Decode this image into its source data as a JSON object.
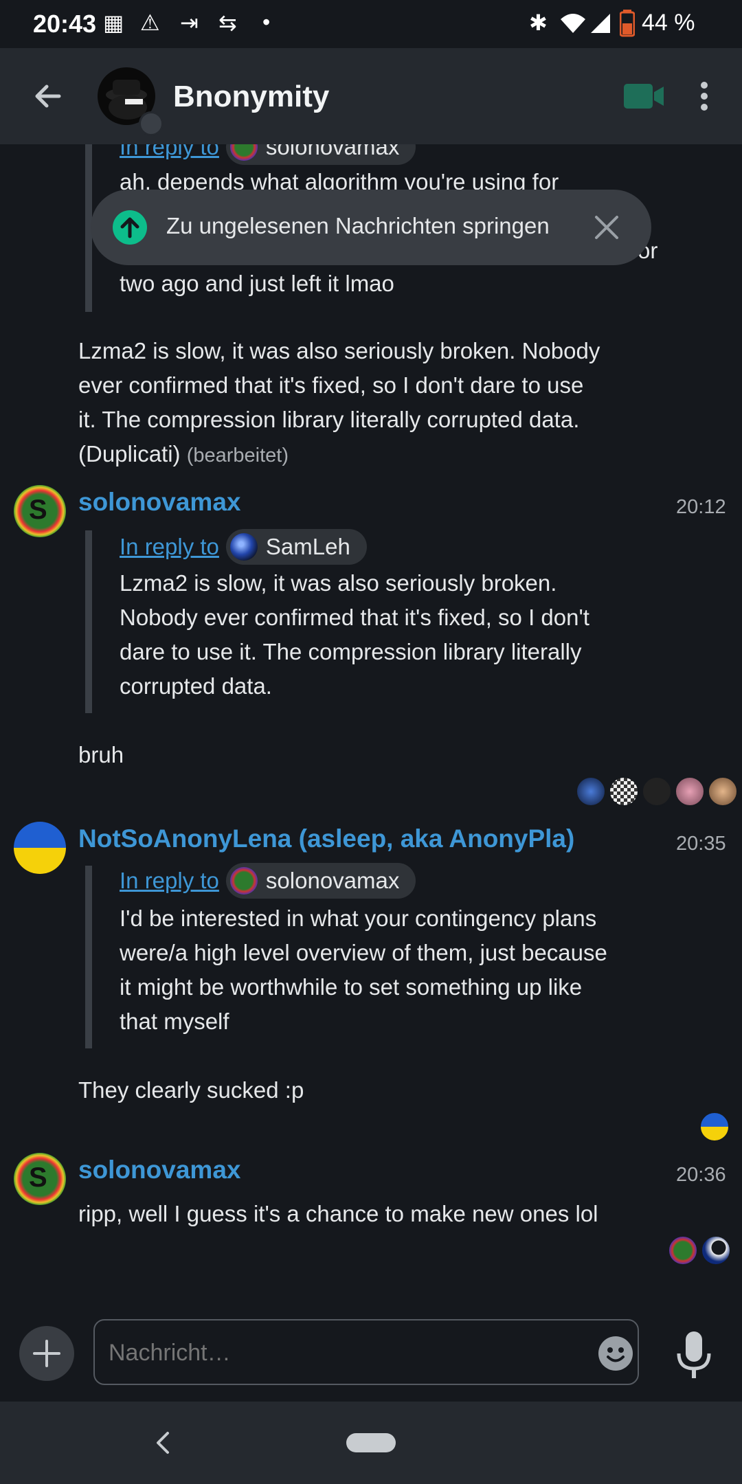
{
  "status_bar": {
    "time": "20:43",
    "battery": "44 %",
    "icons": [
      "grid-icon",
      "warning-icon",
      "cast-icon",
      "sync-icon",
      "dot-icon",
      "bluetooth-icon",
      "wifi-icon",
      "signal-icon",
      "battery-icon"
    ]
  },
  "header": {
    "title": "Bnonymity",
    "back_icon": "arrow-left-icon",
    "video_icon": "video-camera-icon",
    "menu_icon": "more-vertical-icon"
  },
  "jump_banner": {
    "label": "Zu ungelesenen Nachrichten springen"
  },
  "top_quote": {
    "reply_to": "In reply to",
    "user": "solonovamax",
    "line1": "ah, depends what algorithm you're using for",
    "partial": "or",
    "line3": "two ago and just left it lmao"
  },
  "msg_a": {
    "text_lines": [
      "Lzma2 is slow, it was also seriously broken. Nobody",
      "ever confirmed that it's fixed, so I don't dare to use",
      "it. The compression library literally corrupted data."
    ],
    "last_line": "(Duplicati)",
    "edited": "(bearbeitet)"
  },
  "msg_b": {
    "sender": "solonovamax",
    "time": "20:12",
    "reply_to": "In reply to",
    "reply_user": "SamLeh",
    "quote_lines": [
      "Lzma2 is slow, it was also seriously broken.",
      "Nobody ever confirmed that it's fixed, so I don't",
      "dare to use it. The compression library literally",
      "corrupted data."
    ],
    "text": "bruh"
  },
  "msg_c": {
    "sender": "NotSoAnonyLena (asleep, aka AnonyPla)",
    "time": "20:35",
    "reply_to": "In reply to",
    "reply_user": "solonovamax",
    "quote_lines": [
      "I'd be interested in what your contingency plans",
      "were/a high level overview of them, just because",
      "it might be worthwhile to set something up like",
      "that myself"
    ],
    "text": "They clearly sucked :p"
  },
  "msg_d": {
    "sender": "solonovamax",
    "time": "20:36",
    "text": "ripp, well I guess it's a chance to make new ones lol"
  },
  "composer": {
    "placeholder": "Nachricht…"
  },
  "colors": {
    "background": "#15181d",
    "bar": "#25292f",
    "link": "#3e97d6",
    "accent": "#0dbd8b"
  }
}
